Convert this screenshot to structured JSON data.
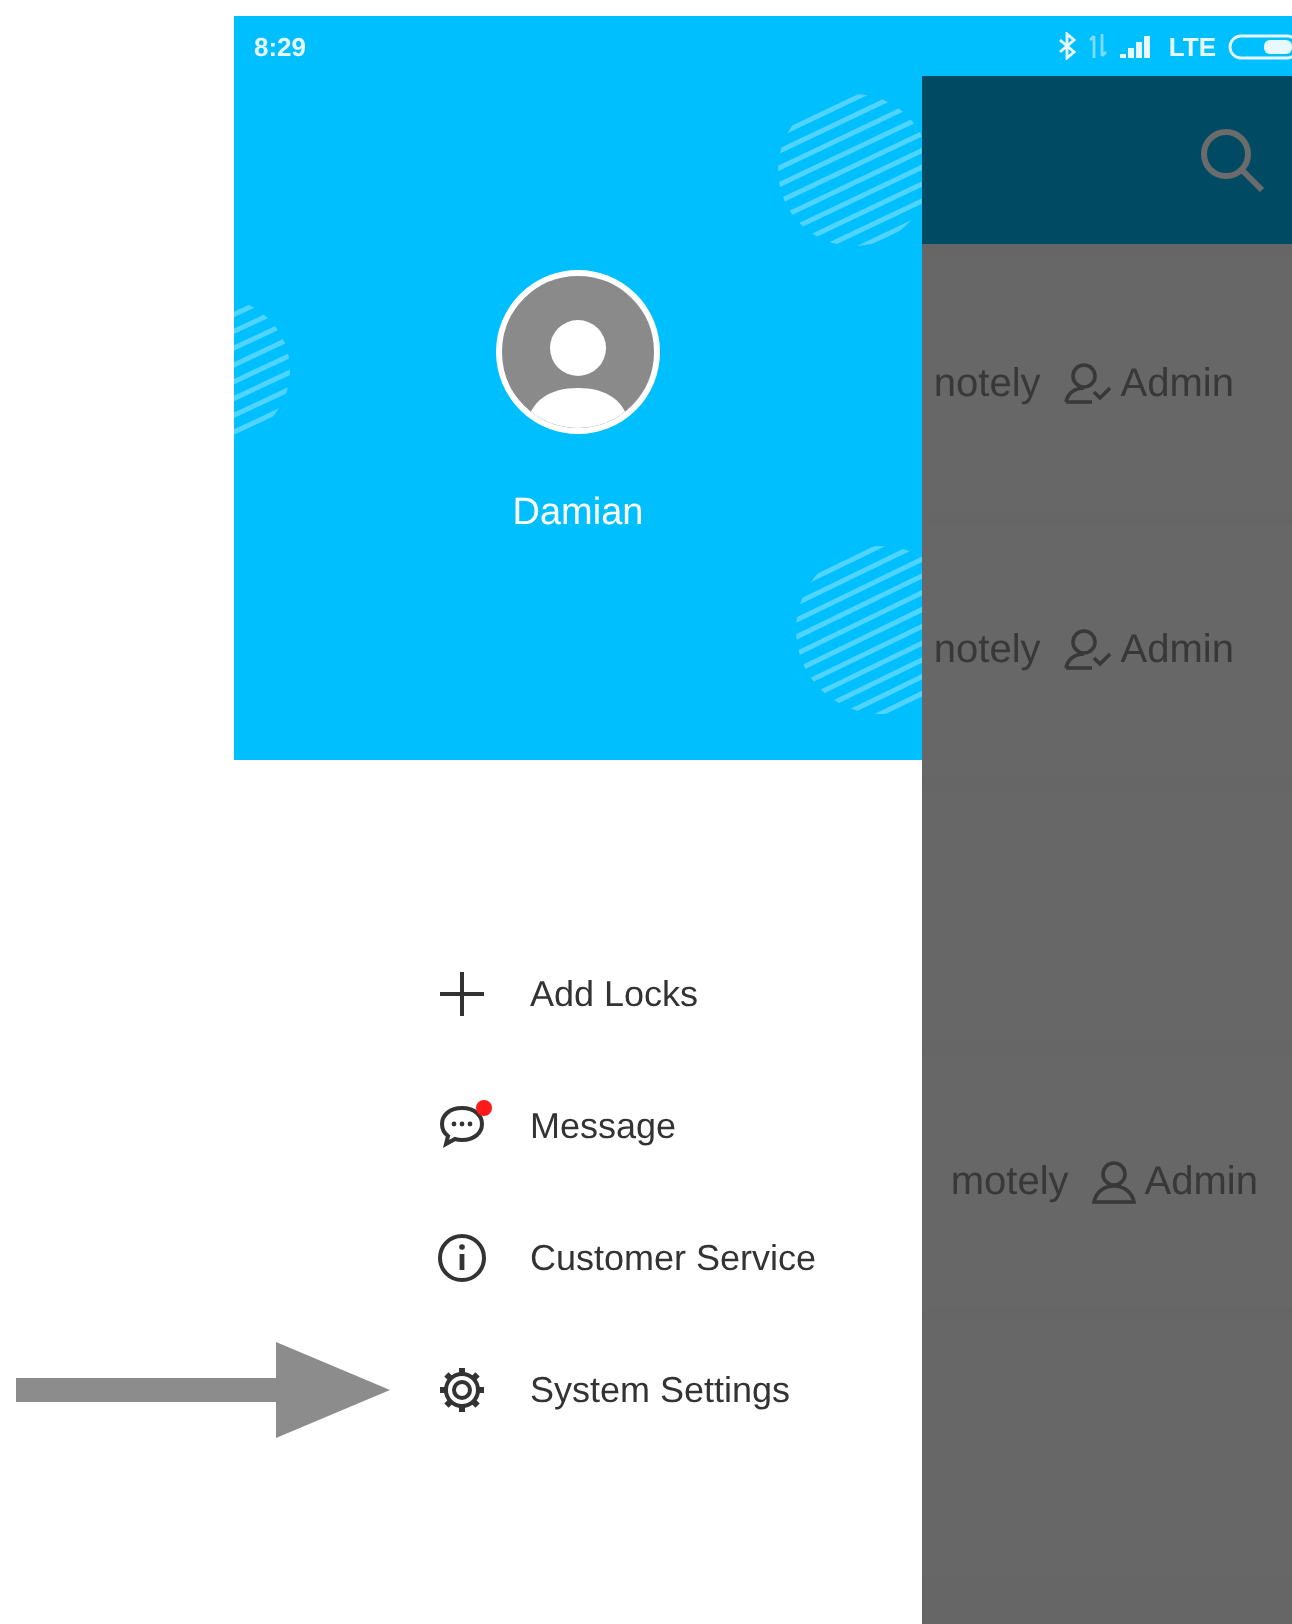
{
  "status_bar": {
    "time": "8:29",
    "network": "LTE"
  },
  "drawer": {
    "user_name": "Damian",
    "menu": [
      {
        "kind": "add",
        "label": "Add Locks",
        "notification": false,
        "pointed": false
      },
      {
        "kind": "message",
        "label": "Message",
        "notification": true,
        "pointed": false
      },
      {
        "kind": "info",
        "label": "Customer Service",
        "notification": false,
        "pointed": false
      },
      {
        "kind": "settings",
        "label": "System Settings",
        "notification": false,
        "pointed": true
      }
    ]
  },
  "background_list": [
    {
      "kind": "access",
      "mode": "notely",
      "role": "Admin",
      "verified": true
    },
    {
      "kind": "access",
      "mode": "notely",
      "role": "Admin",
      "verified": true
    },
    {
      "kind": "blank"
    },
    {
      "kind": "access",
      "mode": "motely",
      "role": "Admin",
      "verified": false
    },
    {
      "kind": "blank"
    }
  ]
}
